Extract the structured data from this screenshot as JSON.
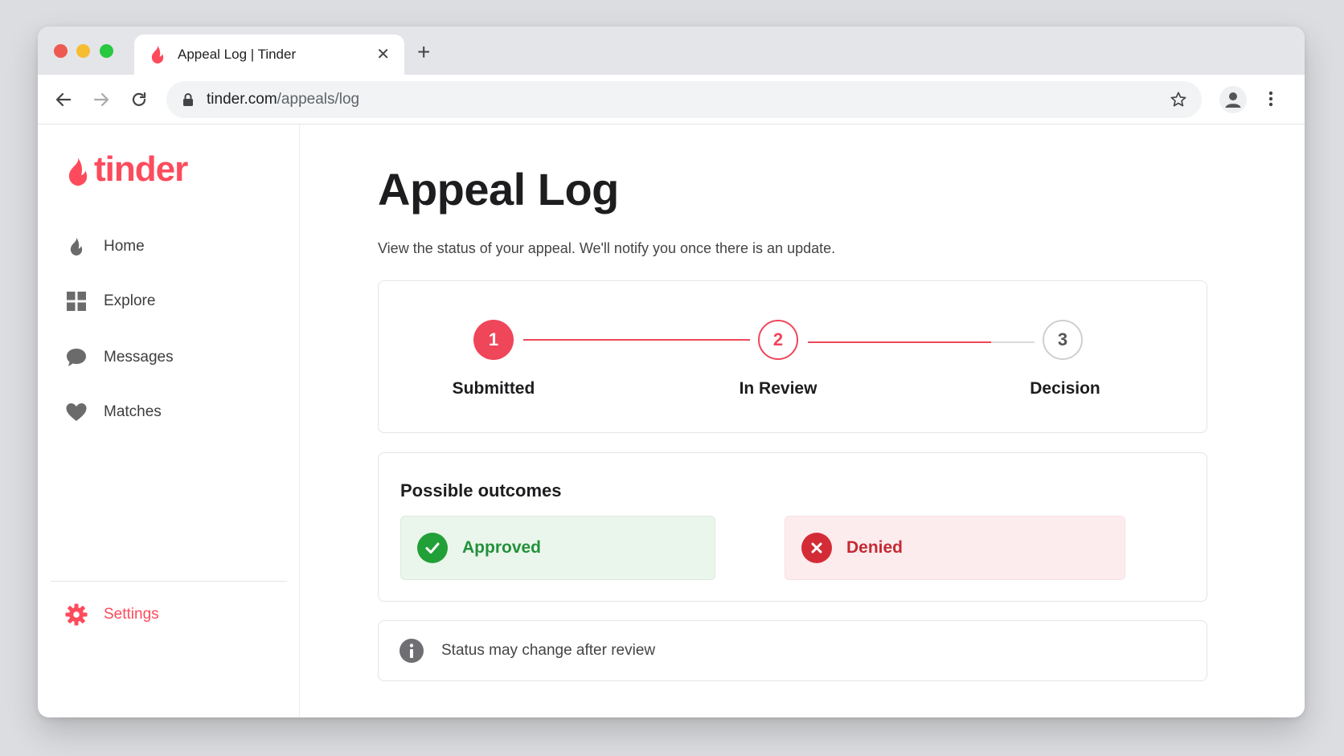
{
  "browser": {
    "tab_title": "Appeal Log | Tinder",
    "url_host": "tinder.com",
    "url_path": "/appeals/log"
  },
  "brand": {
    "logo_text": "tinder",
    "accent_color": "#fd4b5c"
  },
  "sidebar": {
    "items": [
      {
        "label": "Home",
        "icon": "flame-icon"
      },
      {
        "label": "Explore",
        "icon": "grid-icon"
      },
      {
        "label": "Messages",
        "icon": "chat-bubble-icon"
      },
      {
        "label": "Matches",
        "icon": "heart-icon"
      }
    ],
    "settings_label": "Settings"
  },
  "main": {
    "title": "Appeal Log",
    "subtitle": "View the status of your appeal. We'll notify you once there is an update.",
    "steps": [
      {
        "number": "1",
        "label": "Submitted",
        "state": "complete"
      },
      {
        "number": "2",
        "label": "In Review",
        "state": "current"
      },
      {
        "number": "3",
        "label": "Decision",
        "state": "pending"
      }
    ],
    "outcomes": {
      "title": "Possible outcomes",
      "approved_label": "Approved",
      "denied_label": "Denied",
      "approved_color": "#22a038",
      "denied_color": "#d32c36"
    },
    "note": "Status may change after review"
  }
}
